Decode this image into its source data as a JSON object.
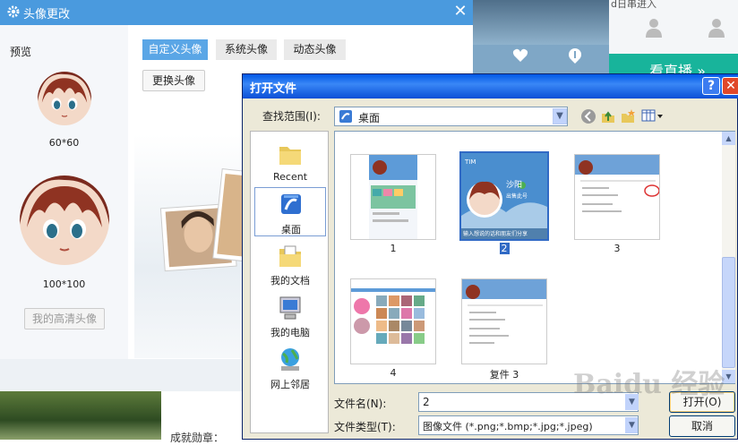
{
  "avatar_dialog": {
    "title": "头像更改",
    "close_symbol": "✕",
    "preview_label": "预览",
    "small_size": "60*60",
    "large_size": "100*100",
    "hd_button": "我的高清头像",
    "tabs": [
      {
        "label": "自定义头像",
        "active": true
      },
      {
        "label": "系统头像",
        "active": false
      },
      {
        "label": "动态头像",
        "active": false
      }
    ],
    "change_button": "更换头像",
    "achievement_text": "成就勋章："
  },
  "background_page": {
    "banner_text": "看直播 »",
    "top_text": "d日串进入"
  },
  "file_dialog": {
    "title": "打开文件",
    "help": "?",
    "close": "✕",
    "lookin_label": "查找范围(I):",
    "lookin_value": "桌面",
    "places": [
      {
        "label": "Recent",
        "icon": "recent-folder-icon"
      },
      {
        "label": "桌面",
        "icon": "desktop-icon",
        "selected": true
      },
      {
        "label": "我的文档",
        "icon": "my-documents-icon"
      },
      {
        "label": "我的电脑",
        "icon": "my-computer-icon"
      },
      {
        "label": "网上邻居",
        "icon": "network-places-icon"
      }
    ],
    "files": [
      {
        "label": "1",
        "selected": false
      },
      {
        "label": "2",
        "selected": true
      },
      {
        "label": "3",
        "selected": false
      },
      {
        "label": "4",
        "selected": false
      },
      {
        "label": "复件 3",
        "selected": false
      }
    ],
    "thumb_texts": {
      "name": "沙阳",
      "status": "出售此号",
      "prompt": "输入想说的话和朋友们分享",
      "header": "TIM"
    },
    "filename_label": "文件名(N):",
    "filename_value": "2",
    "filetype_label": "文件类型(T):",
    "filetype_value": "图像文件 (*.png;*.bmp;*.jpg;*.jpeg)",
    "open_button": "打开(O)",
    "cancel_button": "取消"
  },
  "watermark": "Baidu 经验"
}
